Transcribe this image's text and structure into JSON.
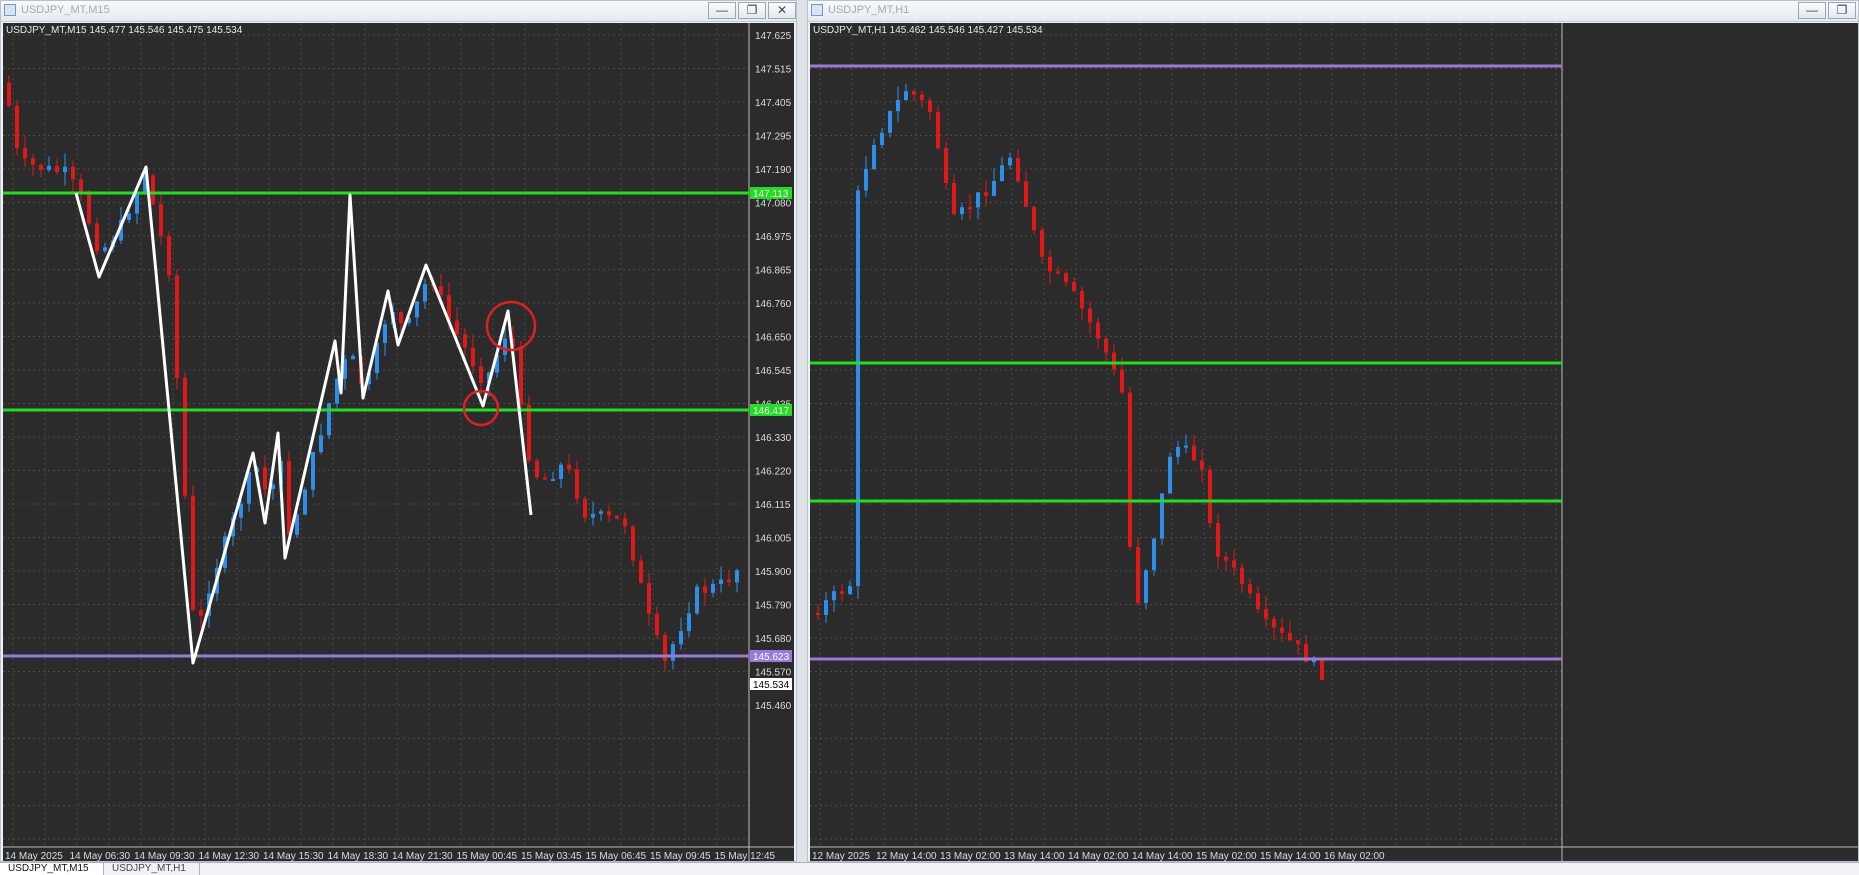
{
  "windows": {
    "left": {
      "title": "USDJPY_MT,M15",
      "symbol_info": "USDJPY_MT,M15  145.477 145.546 145.475 145.534",
      "price_labels": [
        "147.625",
        "147.515",
        "147.405",
        "147.295",
        "147.190",
        "147.080",
        "146.975",
        "146.865",
        "146.760",
        "146.650",
        "146.545",
        "146.435",
        "146.330",
        "146.220",
        "146.115",
        "146.005",
        "145.900",
        "145.790",
        "145.680",
        "145.570",
        "145.460"
      ],
      "time_labels": [
        "14 May 2025",
        "14 May 06:30",
        "14 May 09:30",
        "14 May 12:30",
        "14 May 15:30",
        "14 May 18:30",
        "14 May 21:30",
        "15 May 00:45",
        "15 May 03:45",
        "15 May 06:45",
        "15 May 09:45",
        "15 May 12:45"
      ],
      "levels": [
        {
          "label": "147.113",
          "color": "#22dd22"
        },
        {
          "label": "146.417",
          "color": "#22dd22"
        },
        {
          "label": "145.623",
          "color": "#9a7ad8"
        }
      ],
      "current_price": "145.534"
    },
    "right": {
      "title": "USDJPY_MT,H1",
      "symbol_info": "USDJPY_MT,H1  145.462 145.546 145.427 145.534",
      "time_labels": [
        "12 May 2025",
        "12 May 14:00",
        "13 May 02:00",
        "13 May 14:00",
        "14 May 02:00",
        "14 May 14:00",
        "15 May 02:00",
        "15 May 14:00",
        "16 May 02:00"
      ]
    }
  },
  "tabs": [
    "USDJPY_MT,M15",
    "USDJPY_MT,H1"
  ],
  "window_buttons": {
    "minimize": "—",
    "restore": "❐",
    "close": "✕"
  },
  "colors": {
    "chart_bg": "#2b2b2b",
    "bull": "#2f8fe8",
    "bear": "#e01818",
    "support": "#22dd22",
    "range_line": "#9a7ad8",
    "annotation": "#ffffff",
    "circle": "#e02020"
  }
}
